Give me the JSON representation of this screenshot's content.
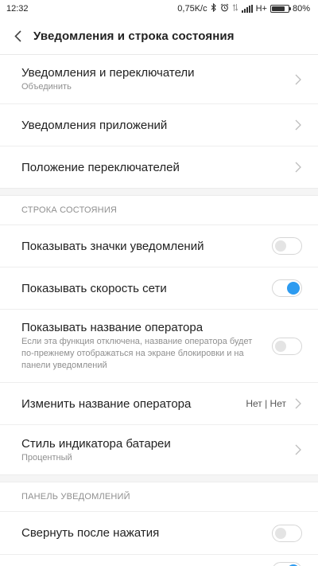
{
  "status_bar": {
    "time": "12:32",
    "net_speed": "0,75K/c",
    "network_type": "H+",
    "battery_percent": "80%",
    "battery_level": 0.8,
    "icons": [
      "bluetooth-icon",
      "alarm-icon",
      "data-transfer-icon",
      "signal-icon",
      "battery-icon"
    ]
  },
  "header": {
    "title": "Уведомления и строка состояния",
    "back_icon": "chevron-left-icon"
  },
  "rows": {
    "notifications_toggles": {
      "title": "Уведомления и переключатели",
      "subtitle": "Объединить"
    },
    "app_notifications": {
      "title": "Уведомления приложений"
    },
    "toggle_position": {
      "title": "Положение переключателей"
    }
  },
  "status_section": {
    "header": "СТРОКА СОСТОЯНИЯ",
    "show_notification_icons": {
      "title": "Показывать значки уведомлений",
      "enabled": false
    },
    "show_net_speed": {
      "title": "Показывать скорость сети",
      "enabled": true
    },
    "show_carrier_name": {
      "title": "Показывать название оператора",
      "subtitle": "Если эта функция отключена, название оператора будет по-прежнему отображаться на экране блокировки и на панели уведомлений",
      "enabled": false
    },
    "change_carrier_name": {
      "title": "Изменить название оператора",
      "value": "Нет | Нет"
    },
    "battery_style": {
      "title": "Стиль индикатора батареи",
      "subtitle": "Процентный"
    }
  },
  "panel_section": {
    "header": "ПАНЕЛЬ УВЕДОМЛЕНИЙ",
    "collapse_after_tap": {
      "title": "Свернуть после нажатия",
      "enabled": false
    },
    "partial_next_row_toggle": {
      "enabled": true
    }
  },
  "colors": {
    "accent": "#2d9bf0",
    "text_primary": "#222222",
    "text_secondary": "#8f8f8f",
    "divider": "#eeeeee",
    "section_gap": "#f5f5f5"
  }
}
